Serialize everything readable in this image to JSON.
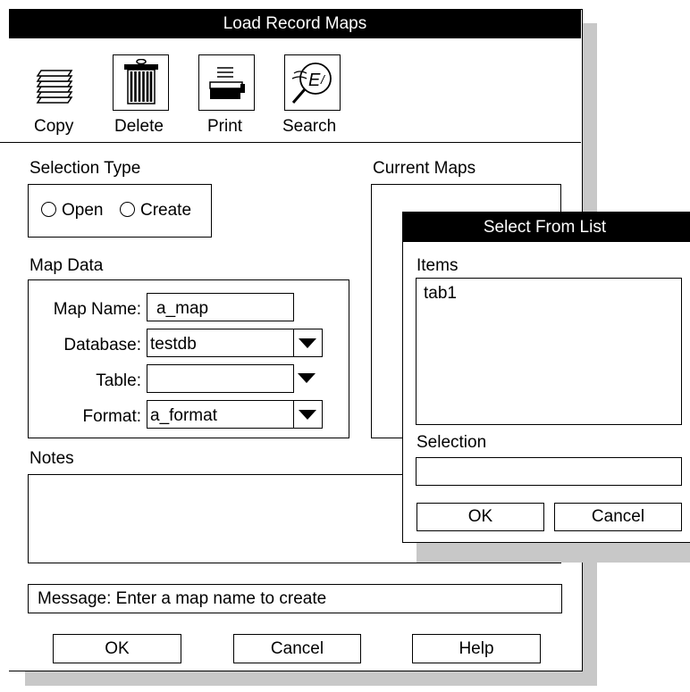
{
  "main_dialog": {
    "title": "Load Record Maps",
    "toolbar": {
      "copy": {
        "label": "Copy",
        "icon": "stack-of-papers-icon"
      },
      "delete": {
        "label": "Delete",
        "icon": "trash-can-icon"
      },
      "print": {
        "label": "Print",
        "icon": "printer-icon"
      },
      "search": {
        "label": "Search",
        "icon": "magnifier-icon"
      }
    },
    "selection_type": {
      "heading": "Selection Type",
      "options": [
        "Open",
        "Create"
      ]
    },
    "current_maps": {
      "heading": "Current Maps"
    },
    "map_data": {
      "heading": "Map Data",
      "map_name": {
        "label": "Map Name:",
        "value": "a_map"
      },
      "database": {
        "label": "Database:",
        "value": "testdb"
      },
      "table": {
        "label": "Table:",
        "value": ""
      },
      "format": {
        "label": "Format:",
        "value": "a_format"
      }
    },
    "notes": {
      "heading": "Notes",
      "value": ""
    },
    "message": {
      "text": "Message:  Enter a map name to create"
    },
    "buttons": {
      "ok": "OK",
      "cancel": "Cancel",
      "help": "Help"
    }
  },
  "list_dialog": {
    "title": "Select From List",
    "items_heading": "Items",
    "items": [
      "tab1"
    ],
    "selection_heading": "Selection",
    "selection_value": "",
    "buttons": {
      "ok": "OK",
      "cancel": "Cancel"
    }
  },
  "colors": {
    "titlebar": "#000000",
    "shadow": "#c8c8c8",
    "background": "#ffffff"
  }
}
